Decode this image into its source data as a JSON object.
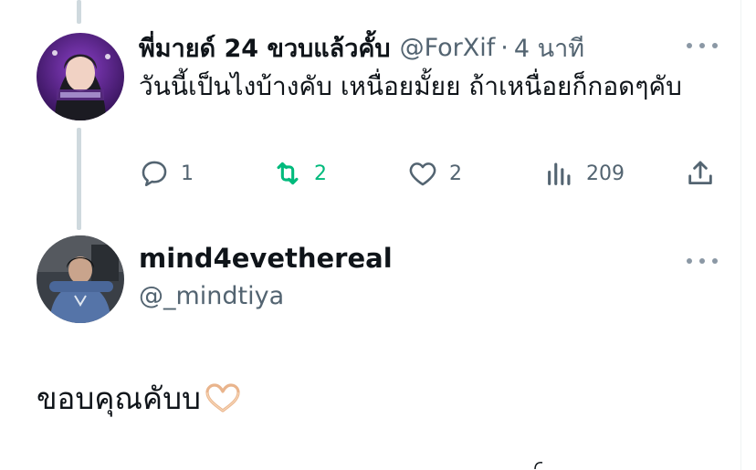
{
  "tweet": {
    "display_name": "พี่มายด์ 24 ขวบแล้วคั้บ",
    "handle": "@ForXif",
    "separator": "·",
    "time": "4 นาที",
    "text": "วันนี้เป็นไงบ้างคับ เหนื่อยมั้ยย ถ้าเหนื่อยก็กอดๆคับ",
    "actions": {
      "reply_count": "1",
      "retweet_count": "2",
      "like_count": "2",
      "view_count": "209"
    }
  },
  "reply": {
    "display_name": "mind4evethereal",
    "handle": "@_mindtiya",
    "text": "ขอบคุณคับบ"
  },
  "colors": {
    "text": "#0f1419",
    "secondary": "#536471",
    "retweet_green": "#00ba7c",
    "thread_line": "#cfd9de"
  },
  "icons": [
    "reply-icon",
    "retweet-icon",
    "like-icon",
    "views-icon",
    "share-icon",
    "more-icon",
    "heart-hands-emoji"
  ]
}
